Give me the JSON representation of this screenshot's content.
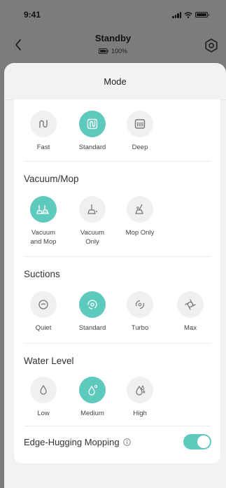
{
  "status": {
    "time": "9:41"
  },
  "header": {
    "title": "Standby",
    "battery": "100%"
  },
  "sheet": {
    "title": "Mode"
  },
  "modes": {
    "options": [
      {
        "label": "Fast",
        "active": false
      },
      {
        "label": "Standard",
        "active": true
      },
      {
        "label": "Deep",
        "active": false
      }
    ]
  },
  "vacuum_mop": {
    "title": "Vacuum/Mop",
    "options": [
      {
        "label": "Vacuum and Mop",
        "active": true
      },
      {
        "label": "Vacuum Only",
        "active": false
      },
      {
        "label": "Mop Only",
        "active": false
      }
    ]
  },
  "suctions": {
    "title": "Suctions",
    "options": [
      {
        "label": "Quiet",
        "active": false
      },
      {
        "label": "Standard",
        "active": true
      },
      {
        "label": "Turbo",
        "active": false
      },
      {
        "label": "Max",
        "active": false
      }
    ]
  },
  "water_level": {
    "title": "Water Level",
    "options": [
      {
        "label": "Low",
        "active": false
      },
      {
        "label": "Medium",
        "active": true
      },
      {
        "label": "High",
        "active": false
      }
    ]
  },
  "edge": {
    "label": "Edge-Hugging Mopping",
    "enabled": true
  },
  "colors": {
    "accent": "#5ec9bd",
    "inactive": "#f0f0f0",
    "overlay": "#7c7c7c"
  }
}
